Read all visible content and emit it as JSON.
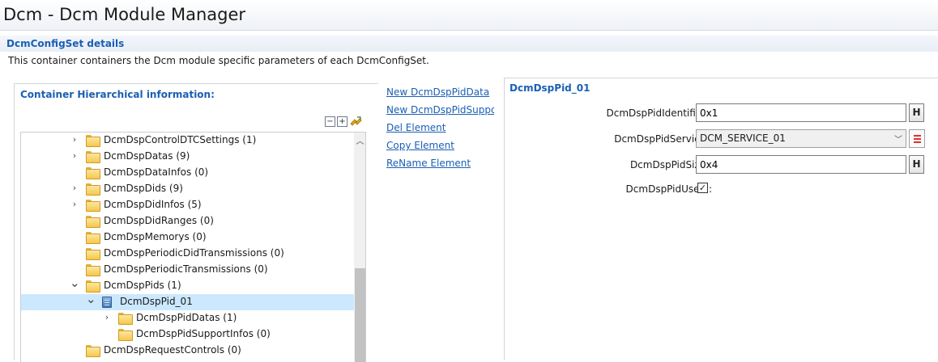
{
  "window": {
    "title": "Dcm - Dcm Module Manager"
  },
  "section": {
    "title": "DcmConfigSet details",
    "description": "This container containers the Dcm module specific parameters of each DcmConfigSet."
  },
  "hierarchy": {
    "title": "Container Hierarchical information:",
    "toolbar_icons": [
      "collapse-all-icon",
      "expand-all-icon",
      "link-sync-icon"
    ],
    "items": [
      {
        "label": "DcmDspControlDTCSettings (1)",
        "expander": "collapsed",
        "icon": "folder-icon"
      },
      {
        "label": "DcmDspDatas (9)",
        "expander": "collapsed",
        "icon": "folder-icon"
      },
      {
        "label": "DcmDspDataInfos (0)",
        "expander": "none",
        "icon": "folder-icon"
      },
      {
        "label": "DcmDspDids (9)",
        "expander": "collapsed",
        "icon": "folder-icon"
      },
      {
        "label": "DcmDspDidInfos (5)",
        "expander": "collapsed",
        "icon": "folder-icon"
      },
      {
        "label": "DcmDspDidRanges (0)",
        "expander": "none",
        "icon": "folder-icon"
      },
      {
        "label": "DcmDspMemorys (0)",
        "expander": "none",
        "icon": "folder-icon"
      },
      {
        "label": "DcmDspPeriodicDidTransmissions (0)",
        "expander": "none",
        "icon": "folder-icon"
      },
      {
        "label": "DcmDspPeriodicTransmissions (0)",
        "expander": "none",
        "icon": "folder-icon"
      },
      {
        "label": "DcmDspPids (1)",
        "expander": "expanded",
        "icon": "folder-icon"
      },
      {
        "label": "DcmDspPid_01",
        "expander": "expanded",
        "icon": "container-icon",
        "selected": true
      },
      {
        "label": "DcmDspPidDatas (1)",
        "expander": "collapsed",
        "icon": "folder-icon"
      },
      {
        "label": "DcmDspPidSupportInfos (0)",
        "expander": "none",
        "icon": "folder-icon"
      },
      {
        "label": "DcmDspRequestControls (0)",
        "expander": "none",
        "icon": "folder-icon"
      }
    ]
  },
  "actions": [
    "New DcmDspPidData",
    "New DcmDspPidSupportInfo",
    "Del Element",
    "Copy Element",
    "ReName Element"
  ],
  "details": {
    "title": "DcmDspPid_01",
    "fields": {
      "identifier": {
        "label": "DcmDspPidIdentifier :",
        "value": "0x1",
        "button": "H"
      },
      "service": {
        "label": "DcmDspPidService :",
        "value": "DCM_SERVICE_01"
      },
      "size": {
        "label": "DcmDspPidSize :",
        "value": "0x4",
        "button": "H"
      },
      "used": {
        "label": "DcmDspPidUsed :",
        "checked": true
      }
    }
  },
  "colors": {
    "link": "#1a5fb4",
    "selection": "#cce8ff"
  }
}
